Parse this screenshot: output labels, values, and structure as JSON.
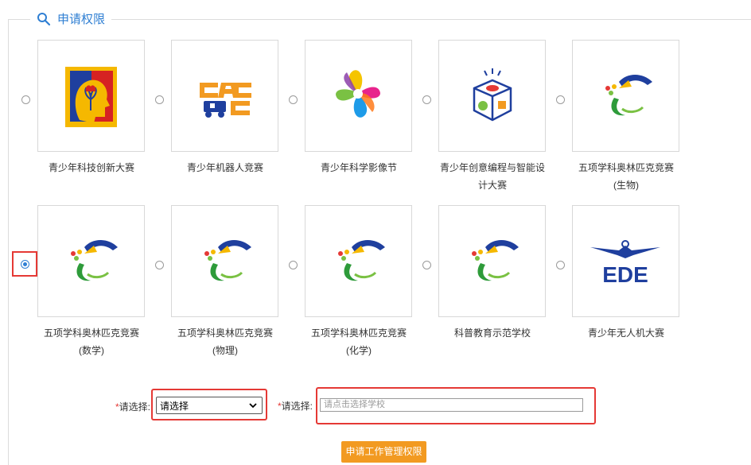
{
  "section": {
    "title": "申请权限",
    "icon": "search-icon"
  },
  "options": [
    {
      "label": "青少年科技创新大赛",
      "logo": "innovation-head-logo-icon",
      "selected": false
    },
    {
      "label": "青少年机器人竞赛",
      "logo": "cac-robot-logo-icon",
      "selected": false
    },
    {
      "label": "青少年科学影像节",
      "logo": "colorful-flower-logo-icon",
      "selected": false
    },
    {
      "label": "青少年创意编程与智能设计大赛",
      "logo": "coding-cube-logo-icon",
      "selected": false
    },
    {
      "label": "五项学科奥林匹克竞赛(生物)",
      "logo": "olympiad-logo-icon",
      "selected": false
    },
    {
      "label": "五项学科奥林匹克竞赛(数学)",
      "logo": "olympiad-logo-icon",
      "selected": true
    },
    {
      "label": "五项学科奥林匹克竞赛(物理)",
      "logo": "olympiad-logo-icon",
      "selected": false
    },
    {
      "label": "五项学科奥林匹克竞赛(化学)",
      "logo": "olympiad-logo-icon",
      "selected": false
    },
    {
      "label": "科普教育示范学校",
      "logo": "olympiad-logo-icon",
      "selected": false
    },
    {
      "label": "青少年无人机大赛",
      "logo": "ede-wings-logo-icon",
      "selected": false
    }
  ],
  "captions": {
    "c0": [
      "青少年科技创新大赛"
    ],
    "c1": [
      "青少年机器人竞赛"
    ],
    "c2": [
      "青少年科学影像节"
    ],
    "c3": [
      "青少年创意编程与智能设",
      "计大赛"
    ],
    "c4": [
      "五项学科奥林匹克竞赛",
      "(生物)"
    ],
    "c5": [
      "五项学科奥林匹克竞赛",
      "(数学)"
    ],
    "c6": [
      "五项学科奥林匹克竞赛",
      "(物理)"
    ],
    "c7": [
      "五项学科奥林匹克竞赛",
      "(化学)"
    ],
    "c8": [
      "科普教育示范学校"
    ],
    "c9": [
      "青少年无人机大赛"
    ]
  },
  "form": {
    "required_mark": "*",
    "select_label": "请选择:",
    "select_value": "请选择",
    "school_label": "请选择:",
    "school_placeholder": "请点击选择学校"
  },
  "submit_label": "申请工作管理权限",
  "colors": {
    "accent": "#2f7fd3",
    "submit": "#f29a21",
    "highlight": "#e53935"
  }
}
